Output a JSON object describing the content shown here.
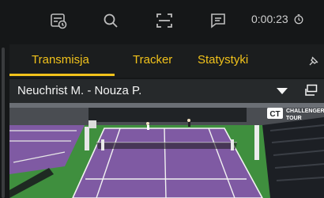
{
  "toolbar": {
    "icons": [
      "calendar-history-icon",
      "search-icon",
      "scan-icon",
      "chat-icon"
    ],
    "timer": "0:00:23"
  },
  "tabs": [
    {
      "label": "Transmisja",
      "active": true
    },
    {
      "label": "Tracker",
      "active": false
    },
    {
      "label": "Statystyki",
      "active": false
    }
  ],
  "match": {
    "title": "Neuchrist M. - Nouza P."
  },
  "video": {
    "watermark": "CHALLENGER TOUR",
    "court_color": "#7f5aa3",
    "surround_color": "#3f8f3e"
  },
  "colors": {
    "accent": "#f1c21b",
    "background": "#151718"
  }
}
